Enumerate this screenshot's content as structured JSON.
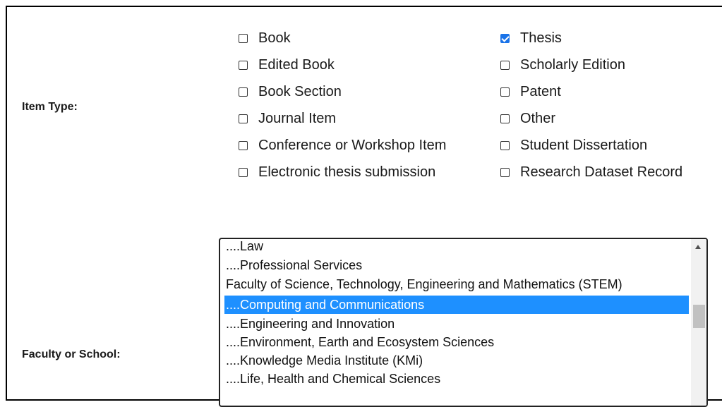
{
  "item_type": {
    "label": "Item Type:",
    "options_left": [
      {
        "label": "Book",
        "checked": false
      },
      {
        "label": "Edited Book",
        "checked": false
      },
      {
        "label": "Book Section",
        "checked": false
      },
      {
        "label": "Journal Item",
        "checked": false
      },
      {
        "label": "Conference or Workshop Item",
        "checked": false
      },
      {
        "label": "Electronic thesis submission",
        "checked": false
      }
    ],
    "options_right": [
      {
        "label": "Thesis",
        "checked": true
      },
      {
        "label": "Scholarly Edition",
        "checked": false
      },
      {
        "label": "Patent",
        "checked": false
      },
      {
        "label": "Other",
        "checked": false
      },
      {
        "label": "Student Dissertation",
        "checked": false
      },
      {
        "label": "Research Dataset Record",
        "checked": false
      }
    ]
  },
  "faculty": {
    "label": "Faculty or School:",
    "options": [
      {
        "label": "....Law",
        "selected": false
      },
      {
        "label": "....Professional Services",
        "selected": false
      },
      {
        "label": "Faculty of Science, Technology, Engineering and Mathematics (STEM)",
        "selected": false
      },
      {
        "label": "....Computing and Communications",
        "selected": true
      },
      {
        "label": "....Engineering and Innovation",
        "selected": false
      },
      {
        "label": "....Environment, Earth and Ecosystem Sciences",
        "selected": false
      },
      {
        "label": "....Knowledge Media Institute (KMi)",
        "selected": false
      },
      {
        "label": "....Life, Health and Chemical Sciences",
        "selected": false
      }
    ]
  },
  "colors": {
    "checkbox_accent": "#1a73e8",
    "selection": "#1e90ff"
  }
}
